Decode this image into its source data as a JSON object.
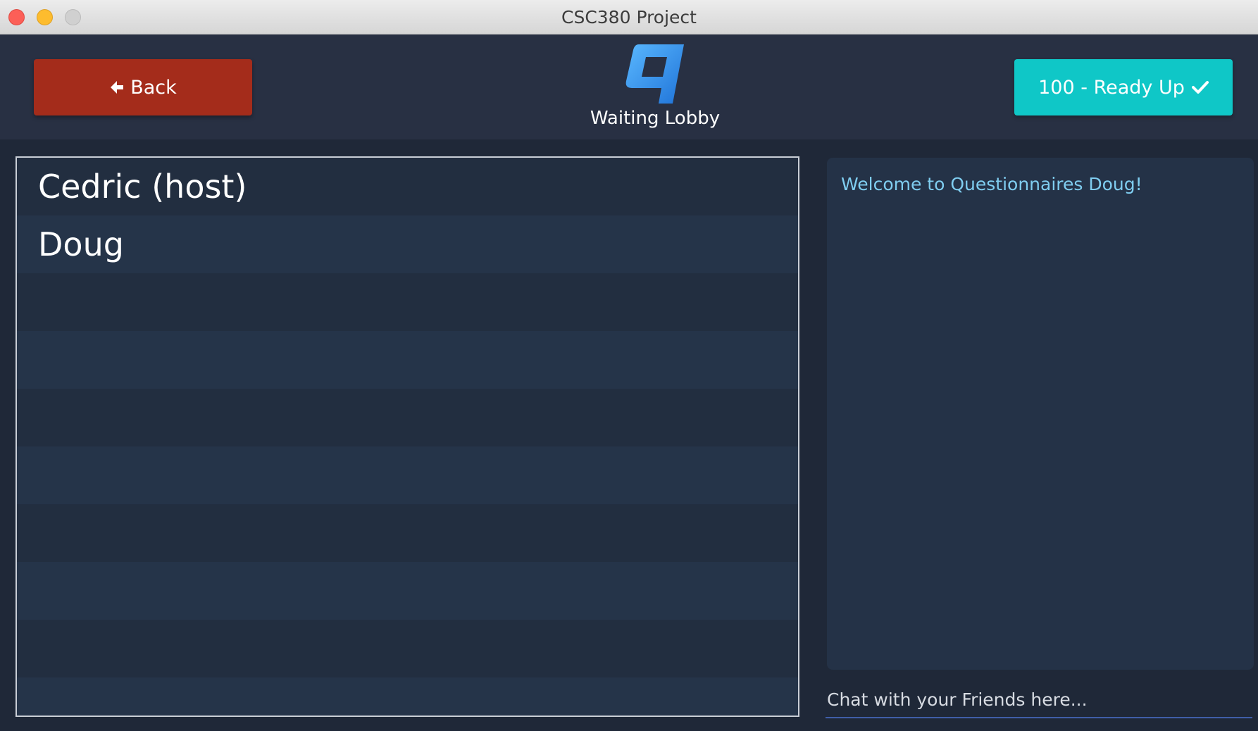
{
  "window": {
    "title": "CSC380 Project"
  },
  "header": {
    "back_label": "Back",
    "back_icon": "arrow-left-icon",
    "ready_label": "100 - Ready Up",
    "ready_icon": "check-icon",
    "logo_icon": "q-logo-icon",
    "lobby_title": "Waiting Lobby"
  },
  "players": [
    "Cedric (host)",
    "Doug",
    "",
    "",
    "",
    "",
    "",
    "",
    "",
    ""
  ],
  "chat": {
    "messages": [
      "Welcome to Questionnaires Doug!"
    ],
    "placeholder": "Chat with your Friends here...",
    "value": ""
  },
  "colors": {
    "background": "#1f2838",
    "header": "#283043",
    "back_button": "#a42c1b",
    "ready_button": "#0fc7c7",
    "chat_text": "#7fcdf0"
  }
}
